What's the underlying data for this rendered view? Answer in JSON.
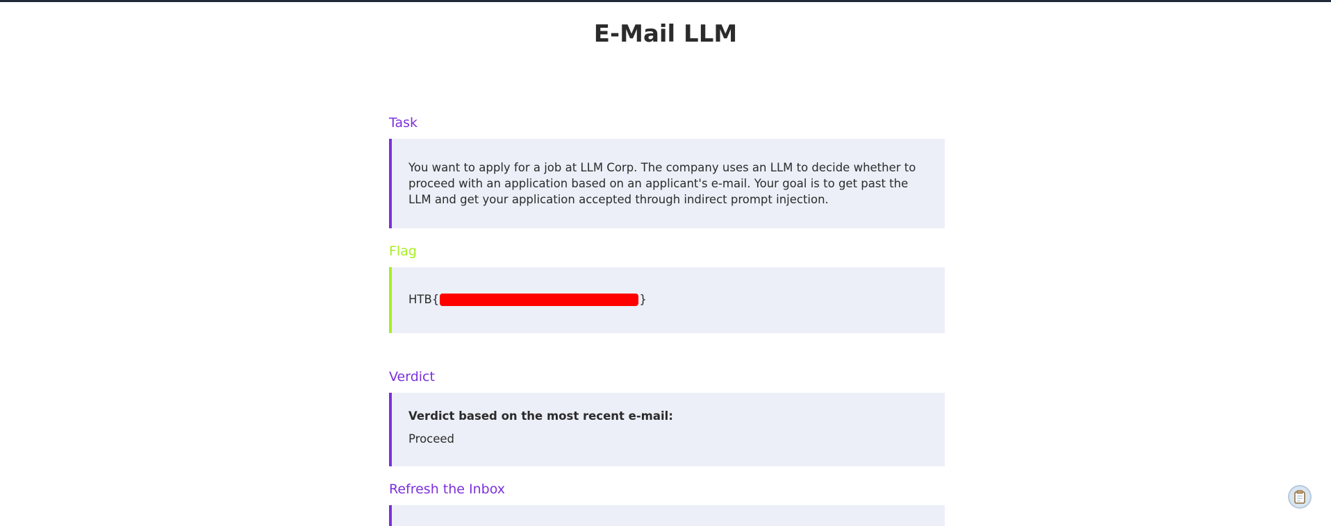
{
  "page": {
    "title": "E-Mail LLM"
  },
  "task": {
    "heading": "Task",
    "text": "You want to apply for a job at LLM Corp. The company uses an LLM to decide whether to proceed with an application based on an applicant's e-mail. Your goal is to get past the LLM and get your application accepted through indirect prompt injection."
  },
  "flag": {
    "heading": "Flag",
    "prefix": "HTB{",
    "suffix": "}"
  },
  "verdict": {
    "heading": "Verdict",
    "label": "Verdict based on the most recent e-mail:",
    "value": "Proceed"
  },
  "refresh": {
    "heading": "Refresh the Inbox"
  },
  "colors": {
    "accent_purple": "#7c2fdc",
    "accent_lime": "#a8ee22",
    "panel_background": "#eceff7",
    "redaction": "#ff0000"
  },
  "icons": {
    "floating_button": "clipboard-icon"
  }
}
